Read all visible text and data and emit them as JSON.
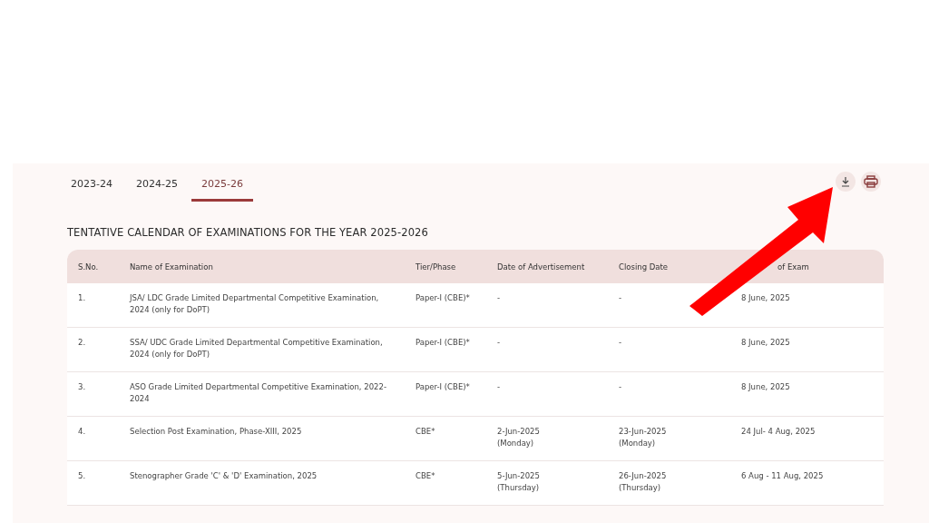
{
  "tabs": [
    {
      "label": "2023-24",
      "selected": false
    },
    {
      "label": "2024-25",
      "selected": false
    },
    {
      "label": "2025-26",
      "selected": true
    }
  ],
  "title": "TENTATIVE CALENDAR OF EXAMINATIONS FOR THE YEAR 2025-2026",
  "table": {
    "columns": [
      "S.No.",
      "Name of Examination",
      "Tier/Phase",
      "Date of Advertisement",
      "Closing Date",
      "of Exam"
    ],
    "rows": [
      {
        "cells": [
          "1.",
          "JSA/ LDC Grade Limited Departmental Competitive Examination, 2024 (only for DoPT)",
          "Paper-I (CBE)*",
          "-",
          "-",
          "8 June, 2025"
        ]
      },
      {
        "cells": [
          "2.",
          "SSA/ UDC Grade Limited Departmental Competitive Examination, 2024 (only for DoPT)",
          "Paper-I (CBE)*",
          "-",
          "-",
          "8 June, 2025"
        ]
      },
      {
        "cells": [
          "3.",
          "ASO Grade Limited Departmental Competitive Examination, 2022-2024",
          "Paper-I (CBE)*",
          "-",
          "-",
          "8 June, 2025"
        ]
      },
      {
        "cells": [
          "4.",
          "Selection Post Examination, Phase-XIII, 2025",
          "CBE*",
          "2-Jun-2025 (Monday)",
          "23-Jun-2025 (Monday)",
          "24 Jul- 4 Aug, 2025"
        ]
      },
      {
        "cells": [
          "5.",
          "Stenographer Grade 'C' & 'D' Examination, 2025",
          "CBE*",
          "5-Jun-2025 (Thursday)",
          "26-Jun-2025 (Thursday)",
          "6 Aug - 11 Aug, 2025"
        ]
      }
    ]
  }
}
